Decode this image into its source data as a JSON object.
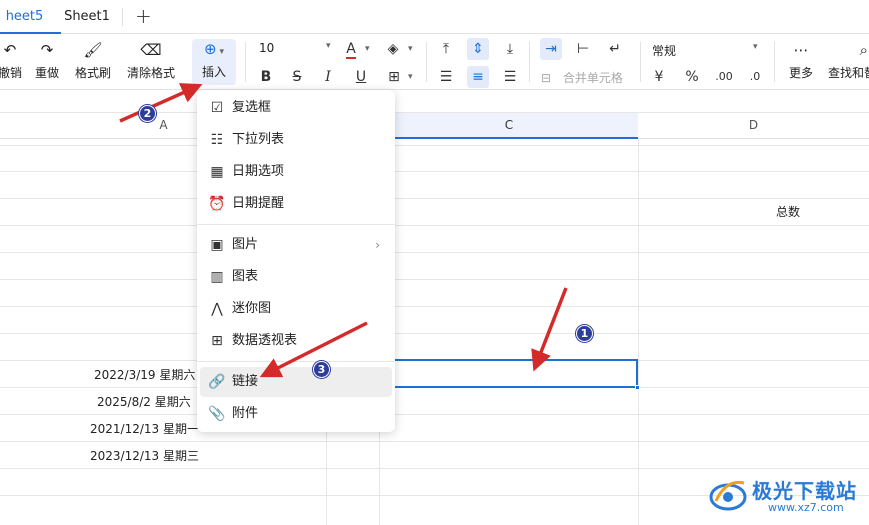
{
  "tabs": {
    "active": "heet5",
    "second": "Sheet1",
    "add": "+"
  },
  "toolbar": {
    "undo_label": "撤销",
    "redo_label": "重做",
    "format_painter_label": "格式刷",
    "clear_format_label": "清除格式",
    "insert_label": "插入",
    "font_size": "10",
    "merge_cells_label": "合并单元格",
    "number_format": "常规",
    "more_label": "更多",
    "find_label": "查找和替",
    "currency_symbol": "¥",
    "percent_symbol": "%",
    "decimal_increase": ".00",
    "decimal_decrease": ".0"
  },
  "grid": {
    "col_a": "A",
    "col_c": "C",
    "col_d": "D",
    "total_label": "总数",
    "dates": [
      "2022/3/19 星期六",
      "2025/8/2 星期六",
      "2021/12/13 星期一",
      "2023/12/13 星期三"
    ]
  },
  "insert_menu": {
    "items": [
      {
        "label": "复选框",
        "icon": "checkbox-icon"
      },
      {
        "label": "下拉列表",
        "icon": "dropdown-list-icon"
      },
      {
        "label": "日期选项",
        "icon": "calendar-icon"
      },
      {
        "label": "日期提醒",
        "icon": "alarm-clock-icon"
      },
      {
        "label": "图片",
        "icon": "image-icon"
      },
      {
        "label": "图表",
        "icon": "chart-icon"
      },
      {
        "label": "迷你图",
        "icon": "sparkline-icon"
      },
      {
        "label": "数据透视表",
        "icon": "pivot-table-icon"
      },
      {
        "label": "链接",
        "icon": "link-icon"
      },
      {
        "label": "附件",
        "icon": "paperclip-icon"
      }
    ]
  },
  "annotations": {
    "step1": "1",
    "step2": "2",
    "step3": "3",
    "arrow_color": "#d42a2a"
  },
  "watermark": {
    "title": "极光下载站",
    "url": "www.xz7.com"
  }
}
